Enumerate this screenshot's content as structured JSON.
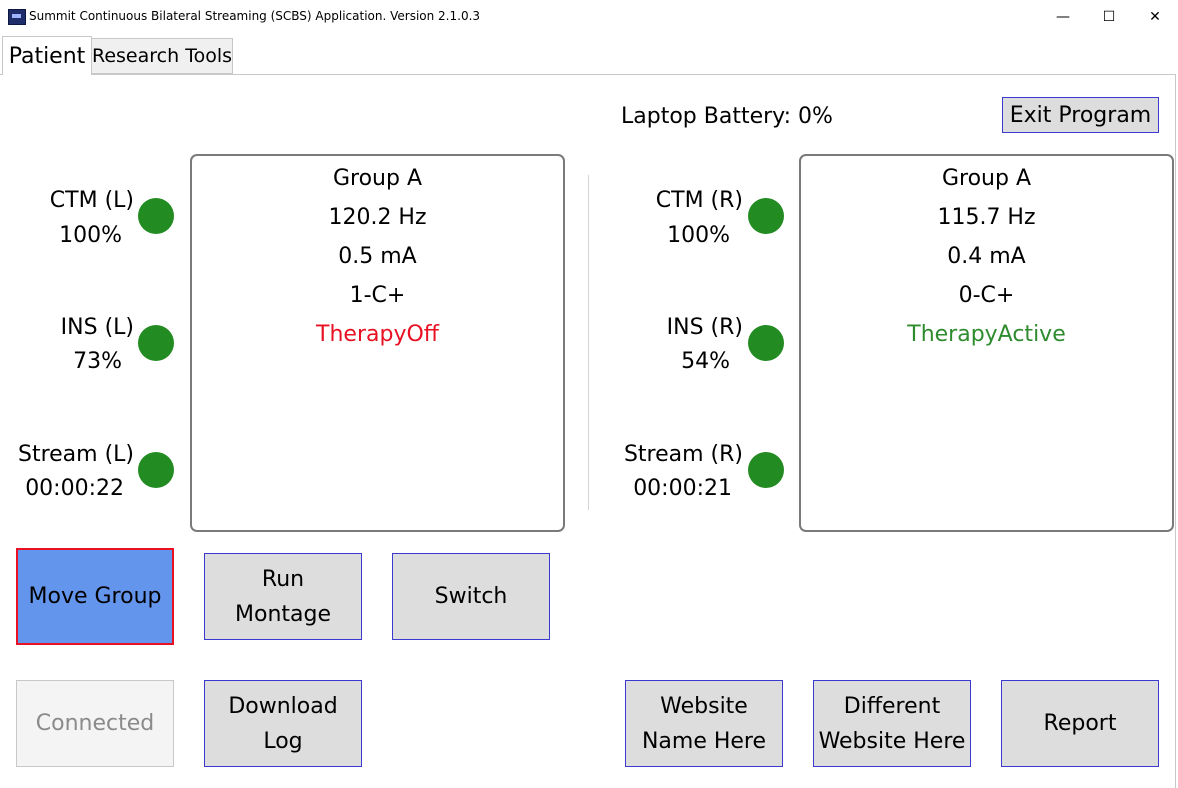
{
  "window": {
    "title": "Summit Continuous Bilateral Streaming (SCBS) Application. Version 2.1.0.3",
    "minimize_glyph": "—",
    "maximize_glyph": "☐",
    "close_glyph": "✕"
  },
  "tabs": [
    {
      "label": "Patient",
      "selected": true
    },
    {
      "label": "Research Tools",
      "selected": false
    }
  ],
  "header": {
    "battery": "Laptop Battery: 0%",
    "exit_label": "Exit Program"
  },
  "left": {
    "ctm_label": "CTM (L)",
    "ctm_value": "100%",
    "ins_label": "INS (L)",
    "ins_value": "73%",
    "stream_label": "Stream (L)",
    "stream_value": "00:00:22",
    "status_color": "#228b22",
    "group": "Group A",
    "frequency": "120.2 Hz",
    "amplitude": "0.5 mA",
    "electrodes": "1-C+",
    "therapy": "TherapyOff",
    "therapy_color": "#e81123"
  },
  "right": {
    "ctm_label": "CTM (R)",
    "ctm_value": "100%",
    "ins_label": "INS (R)",
    "ins_value": "54%",
    "stream_label": "Stream (R)",
    "stream_value": "00:00:21",
    "status_color": "#228b22",
    "group": "Group A",
    "frequency": "115.7 Hz",
    "amplitude": "0.4 mA",
    "electrodes": "0-C+",
    "therapy": "TherapyActive",
    "therapy_color": "#2e8b2e"
  },
  "buttons": {
    "move_group": "Move Group",
    "run_montage_1": "Run",
    "run_montage_2": "Montage",
    "switch": "Switch",
    "connected": "Connected",
    "download_1": "Download",
    "download_2": "Log",
    "website_1": "Website",
    "website_2": "Name Here",
    "different_1": "Different",
    "different_2": "Website Here",
    "report": "Report"
  },
  "colors": {
    "move_group_fill": "#6495ed",
    "move_group_border": "#e81123",
    "button_fill": "#dddddd",
    "button_border": "#3a3ad0",
    "disabled_text": "#8a8a8a"
  }
}
